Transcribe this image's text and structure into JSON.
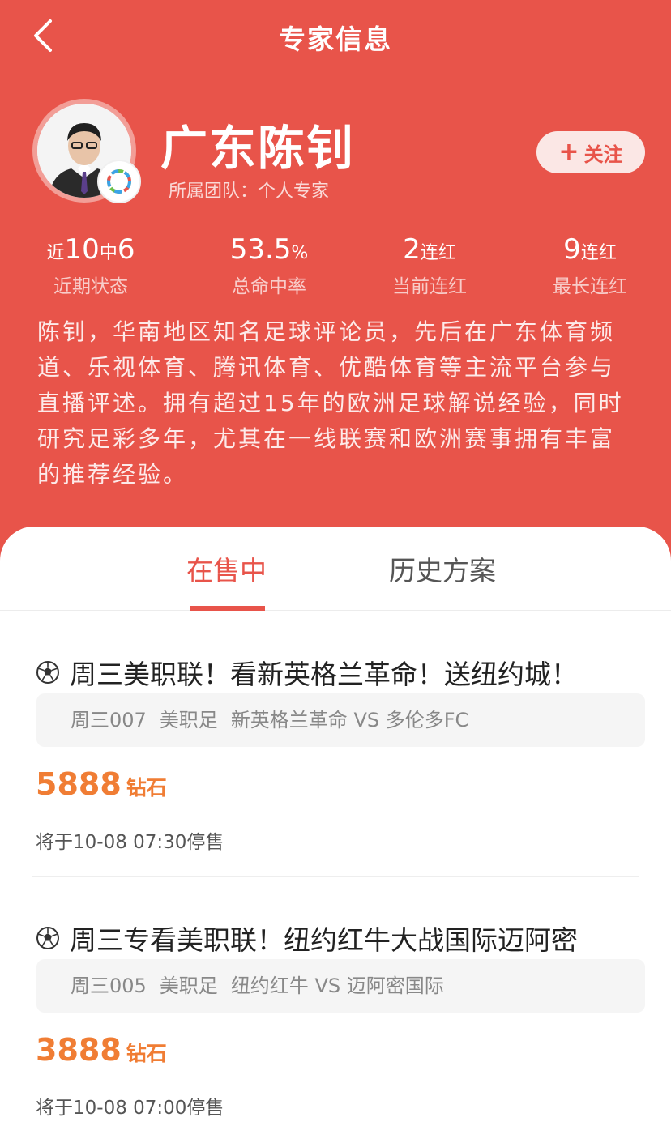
{
  "nav": {
    "title": "专家信息"
  },
  "expert": {
    "name": "广东陈钊",
    "team_label": "所属团队：",
    "team_value": "个人专家",
    "follow_label": "关注"
  },
  "stats": [
    {
      "p1": "近",
      "p2": "10",
      "p3": "中",
      "p4": "6",
      "label": "近期状态"
    },
    {
      "p1": "",
      "p2": "53.5",
      "p3": "%",
      "p4": "",
      "label": "总命中率"
    },
    {
      "p1": "",
      "p2": "2",
      "p3": "连红",
      "p4": "",
      "label": "当前连红"
    },
    {
      "p1": "",
      "p2": "9",
      "p3": "连红",
      "p4": "",
      "label": "最长连红"
    }
  ],
  "intro": "陈钊，华南地区知名足球评论员，先后在广东体育频道、乐视体育、腾讯体育、优酷体育等主流平台参与直播评述。拥有超过15年的欧洲足球解说经验，同时研究足彩多年，尤其在一线联赛和欧洲赛事拥有丰富的推荐经验。",
  "tabs": [
    {
      "label": "在售中"
    },
    {
      "label": "历史方案"
    }
  ],
  "plans": [
    {
      "title": "周三美职联！看新英格兰革命！送纽约城！",
      "match_no": "周三007",
      "league": "美职足",
      "teams": "新英格兰革命 VS 多伦多FC",
      "price": "5888",
      "unit": "钻石",
      "deadline": "将于10-08 07:30停售"
    },
    {
      "title": "周三专看美职联！纽约红牛大战国际迈阿密",
      "match_no": "周三005",
      "league": "美职足",
      "teams": "纽约红牛 VS 迈阿密国际",
      "price": "3888",
      "unit": "钻石",
      "deadline": "将于10-08 07:00停售"
    }
  ],
  "colors": {
    "primary": "#e8544a",
    "price": "#f07d34"
  }
}
